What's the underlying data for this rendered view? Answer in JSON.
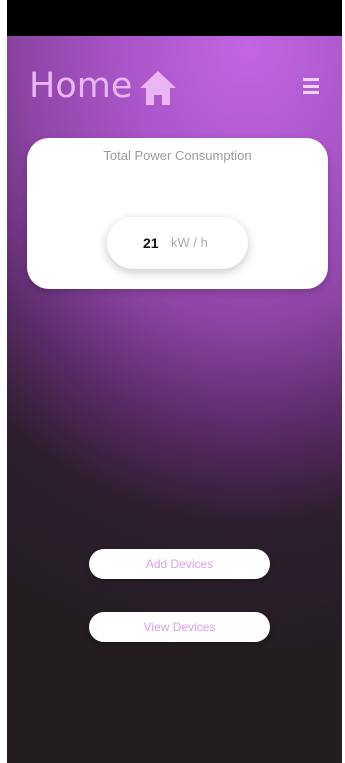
{
  "header": {
    "title": "Home",
    "home_icon": "home-icon",
    "menu_icon": "menu-icon"
  },
  "power_card": {
    "title": "Total Power Consumption",
    "value": "21",
    "unit": "kW / h"
  },
  "actions": {
    "add_devices": "Add Devices",
    "view_devices": "View Devices"
  },
  "colors": {
    "accent": "#c465e2",
    "title_text": "#e9b6f3",
    "button_text": "#dd9ee9",
    "background_dark": "#231d22"
  }
}
